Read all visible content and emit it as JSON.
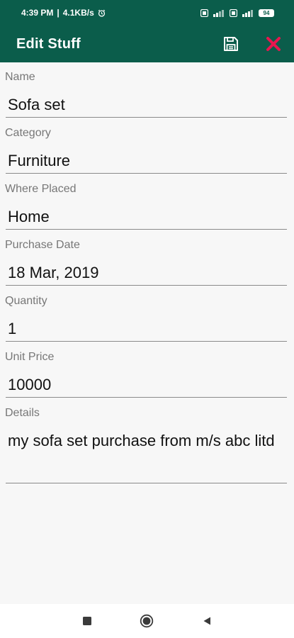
{
  "status_bar": {
    "time": "4:39 PM",
    "separator": "|",
    "net_speed": "4.1KB/s",
    "battery": "94"
  },
  "app_bar": {
    "title": "Edit Stuff",
    "save_icon": "save-icon",
    "close_icon": "close-icon",
    "close_color": "#e8164f"
  },
  "form": {
    "fields": [
      {
        "label": "Name",
        "value": "Sofa set"
      },
      {
        "label": "Category",
        "value": "Furniture"
      },
      {
        "label": "Where Placed",
        "value": "Home"
      },
      {
        "label": "Purchase Date",
        "value": "18 Mar, 2019"
      },
      {
        "label": "Quantity",
        "value": "1"
      },
      {
        "label": "Unit Price",
        "value": "10000"
      },
      {
        "label": "Details",
        "value": "my sofa set purchase from m/s abc litd"
      }
    ]
  },
  "nav_bar": {
    "recents_icon": "square-icon",
    "home_icon": "circle-icon",
    "back_icon": "triangle-back-icon"
  },
  "colors": {
    "primary": "#0b5d4b",
    "accent": "#e8164f"
  }
}
